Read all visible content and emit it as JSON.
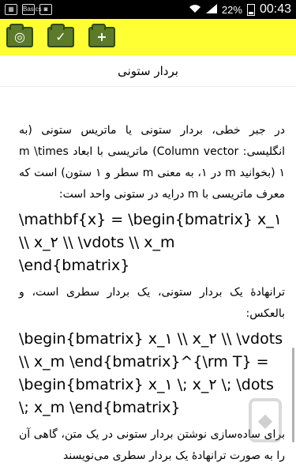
{
  "status_bar": {
    "left_icons": [
      "gallery-icon",
      "app-icon",
      "photo-icon"
    ],
    "app_icon_text": "Basics",
    "battery": "22%",
    "time": "00:43"
  },
  "toolbar": {
    "buttons": [
      {
        "name": "folder-settings-icon",
        "glyph": "◎"
      },
      {
        "name": "folder-check-icon",
        "glyph": "✓"
      },
      {
        "name": "folder-add-icon",
        "glyph": "+"
      }
    ],
    "background": "#ffff33"
  },
  "page": {
    "title": "بردار ستونی"
  },
  "content": {
    "paragraph1": "در جبر خطی، بردار ستونی یا ماتریس ستونی (به انگلیسی: Column vector) ماتریسی با ابعاد m \\times ۱ (بخوانید m در ۱، به معنی m سطر و ۱ ستون) است که معرف ماتریسی با m درایه در ستونی واحد است:",
    "math1": "\\mathbf{x} = \\begin{bmatrix} x_۱ \\\\ x_۲ \\\\ \\vdots \\\\ x_m \\end{bmatrix}",
    "paragraph2": "ترانهادهٔ یک بردار ستونی، یک بردار سطری است، و بالعکس:",
    "math2": "\\begin{bmatrix} x_۱ \\\\ x_۲ \\\\ \\vdots \\\\ x_m \\end{bmatrix}^{\\rm T} = \\begin{bmatrix} x_۱ \\; x_۲ \\; \\dots \\; x_m \\end{bmatrix}",
    "paragraph3": "برای ساده‌سازی نوشتن بردار ستونی در یک متن، گاهی آن را به صورت ترانهادهٔ یک بردار سطری می‌نویسند"
  }
}
